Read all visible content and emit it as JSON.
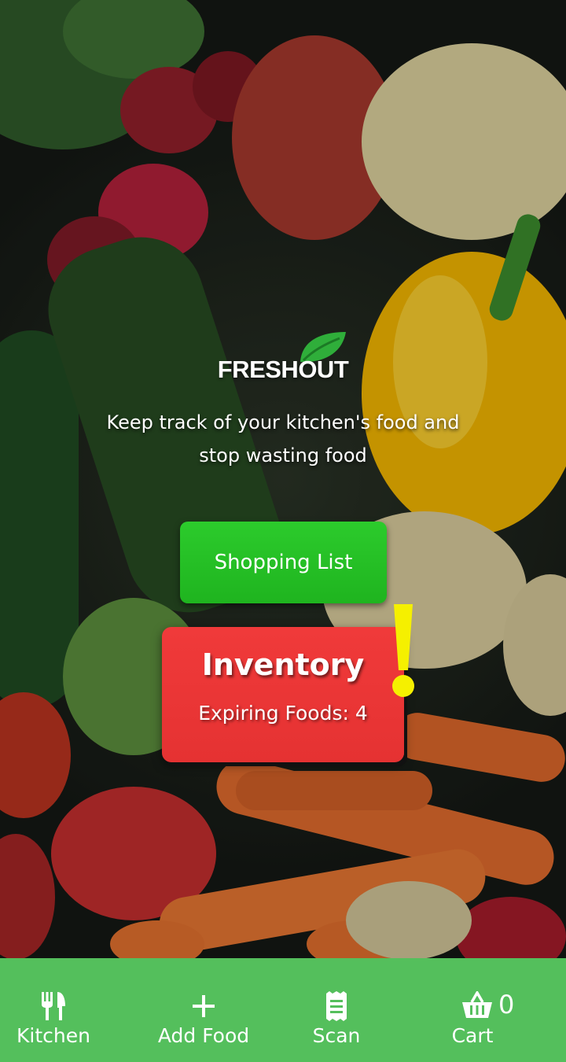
{
  "app": {
    "brand": "FRESHOUT",
    "tagline": "Keep track of your kitchen's food and stop wasting food"
  },
  "actions": {
    "shopping_list_label": "Shopping List",
    "inventory_label": "Inventory",
    "expiring_label": "Expiring Foods: 4",
    "expiring_count": 4
  },
  "nav": {
    "items": [
      {
        "label": "Kitchen",
        "icon": "utensils-icon"
      },
      {
        "label": "Add Food",
        "icon": "plus-icon"
      },
      {
        "label": "Scan",
        "icon": "receipt-icon"
      },
      {
        "label": "Cart",
        "icon": "basket-icon"
      }
    ],
    "cart_count": "0"
  },
  "colors": {
    "nav_bg": "#54bf5c",
    "shopping_button": "#22bb22",
    "inventory_button": "#e83535",
    "alert": "#f5f000",
    "logo_leaf": "#2fae3a"
  }
}
